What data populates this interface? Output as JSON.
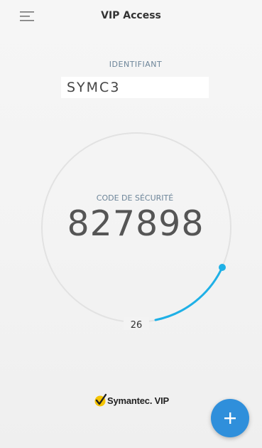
{
  "header": {
    "menu_icon": "hamburger-menu-icon",
    "title": "VIP Access"
  },
  "credential": {
    "label": "IDENTIFIANT",
    "value": "SYMC3"
  },
  "security_code": {
    "label": "CODE DE SÉCURITÉ",
    "value": "827898"
  },
  "timer": {
    "seconds_remaining": "26",
    "progress_color": "#1fb0e6",
    "track_color": "#e2e2e2"
  },
  "branding": {
    "logo_icon": "checkmark-logo-icon",
    "text": "Symantec. VIP",
    "logo_color": "#f5c400"
  },
  "fab": {
    "icon": "plus-icon",
    "color": "#2f8fdb"
  }
}
